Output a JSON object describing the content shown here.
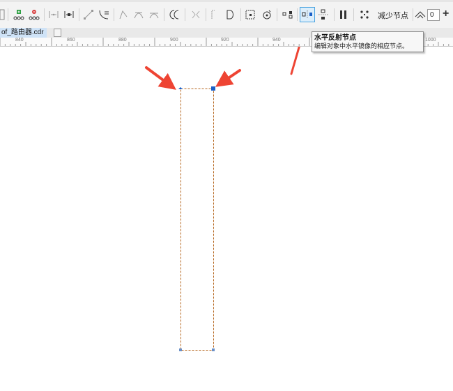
{
  "document": {
    "tab_label": "of_路由器.cdr"
  },
  "ruler": {
    "labels": [
      "840",
      "860",
      "880",
      "900",
      "920",
      "940",
      "1000"
    ]
  },
  "toolbar": {
    "reduce_nodes_label": "减少节点",
    "smoothness_value": "0",
    "increase_symbol": "+",
    "active_tool": "reflect-nodes-horizontal",
    "accent_color": "#4aa3e0",
    "tools": [
      "add-node-icon",
      "delete-node-icon",
      "join-nodes-icon",
      "break-curve-icon",
      "to-line-icon",
      "to-curve-icon",
      "cusp-node-icon",
      "smooth-node-icon",
      "symmetrical-node-icon",
      "reverse-direction-icon",
      "extend-curve-icon",
      "close-curve-icon",
      "extract-subpath-icon",
      "stretch-nodes-icon",
      "rotate-nodes-icon",
      "align-nodes-icon",
      "reflect-horizontal-icon",
      "reflect-vertical-icon",
      "elastic-mode-icon",
      "select-all-nodes-icon"
    ]
  },
  "tooltip": {
    "title": "水平反射节点",
    "description": "编辑对象中水平镜像的相应节点。"
  },
  "colors": {
    "annotation_arrow": "#ee4433",
    "shape_outline": "#b5651d",
    "node_selected": "#1a5fc7"
  }
}
